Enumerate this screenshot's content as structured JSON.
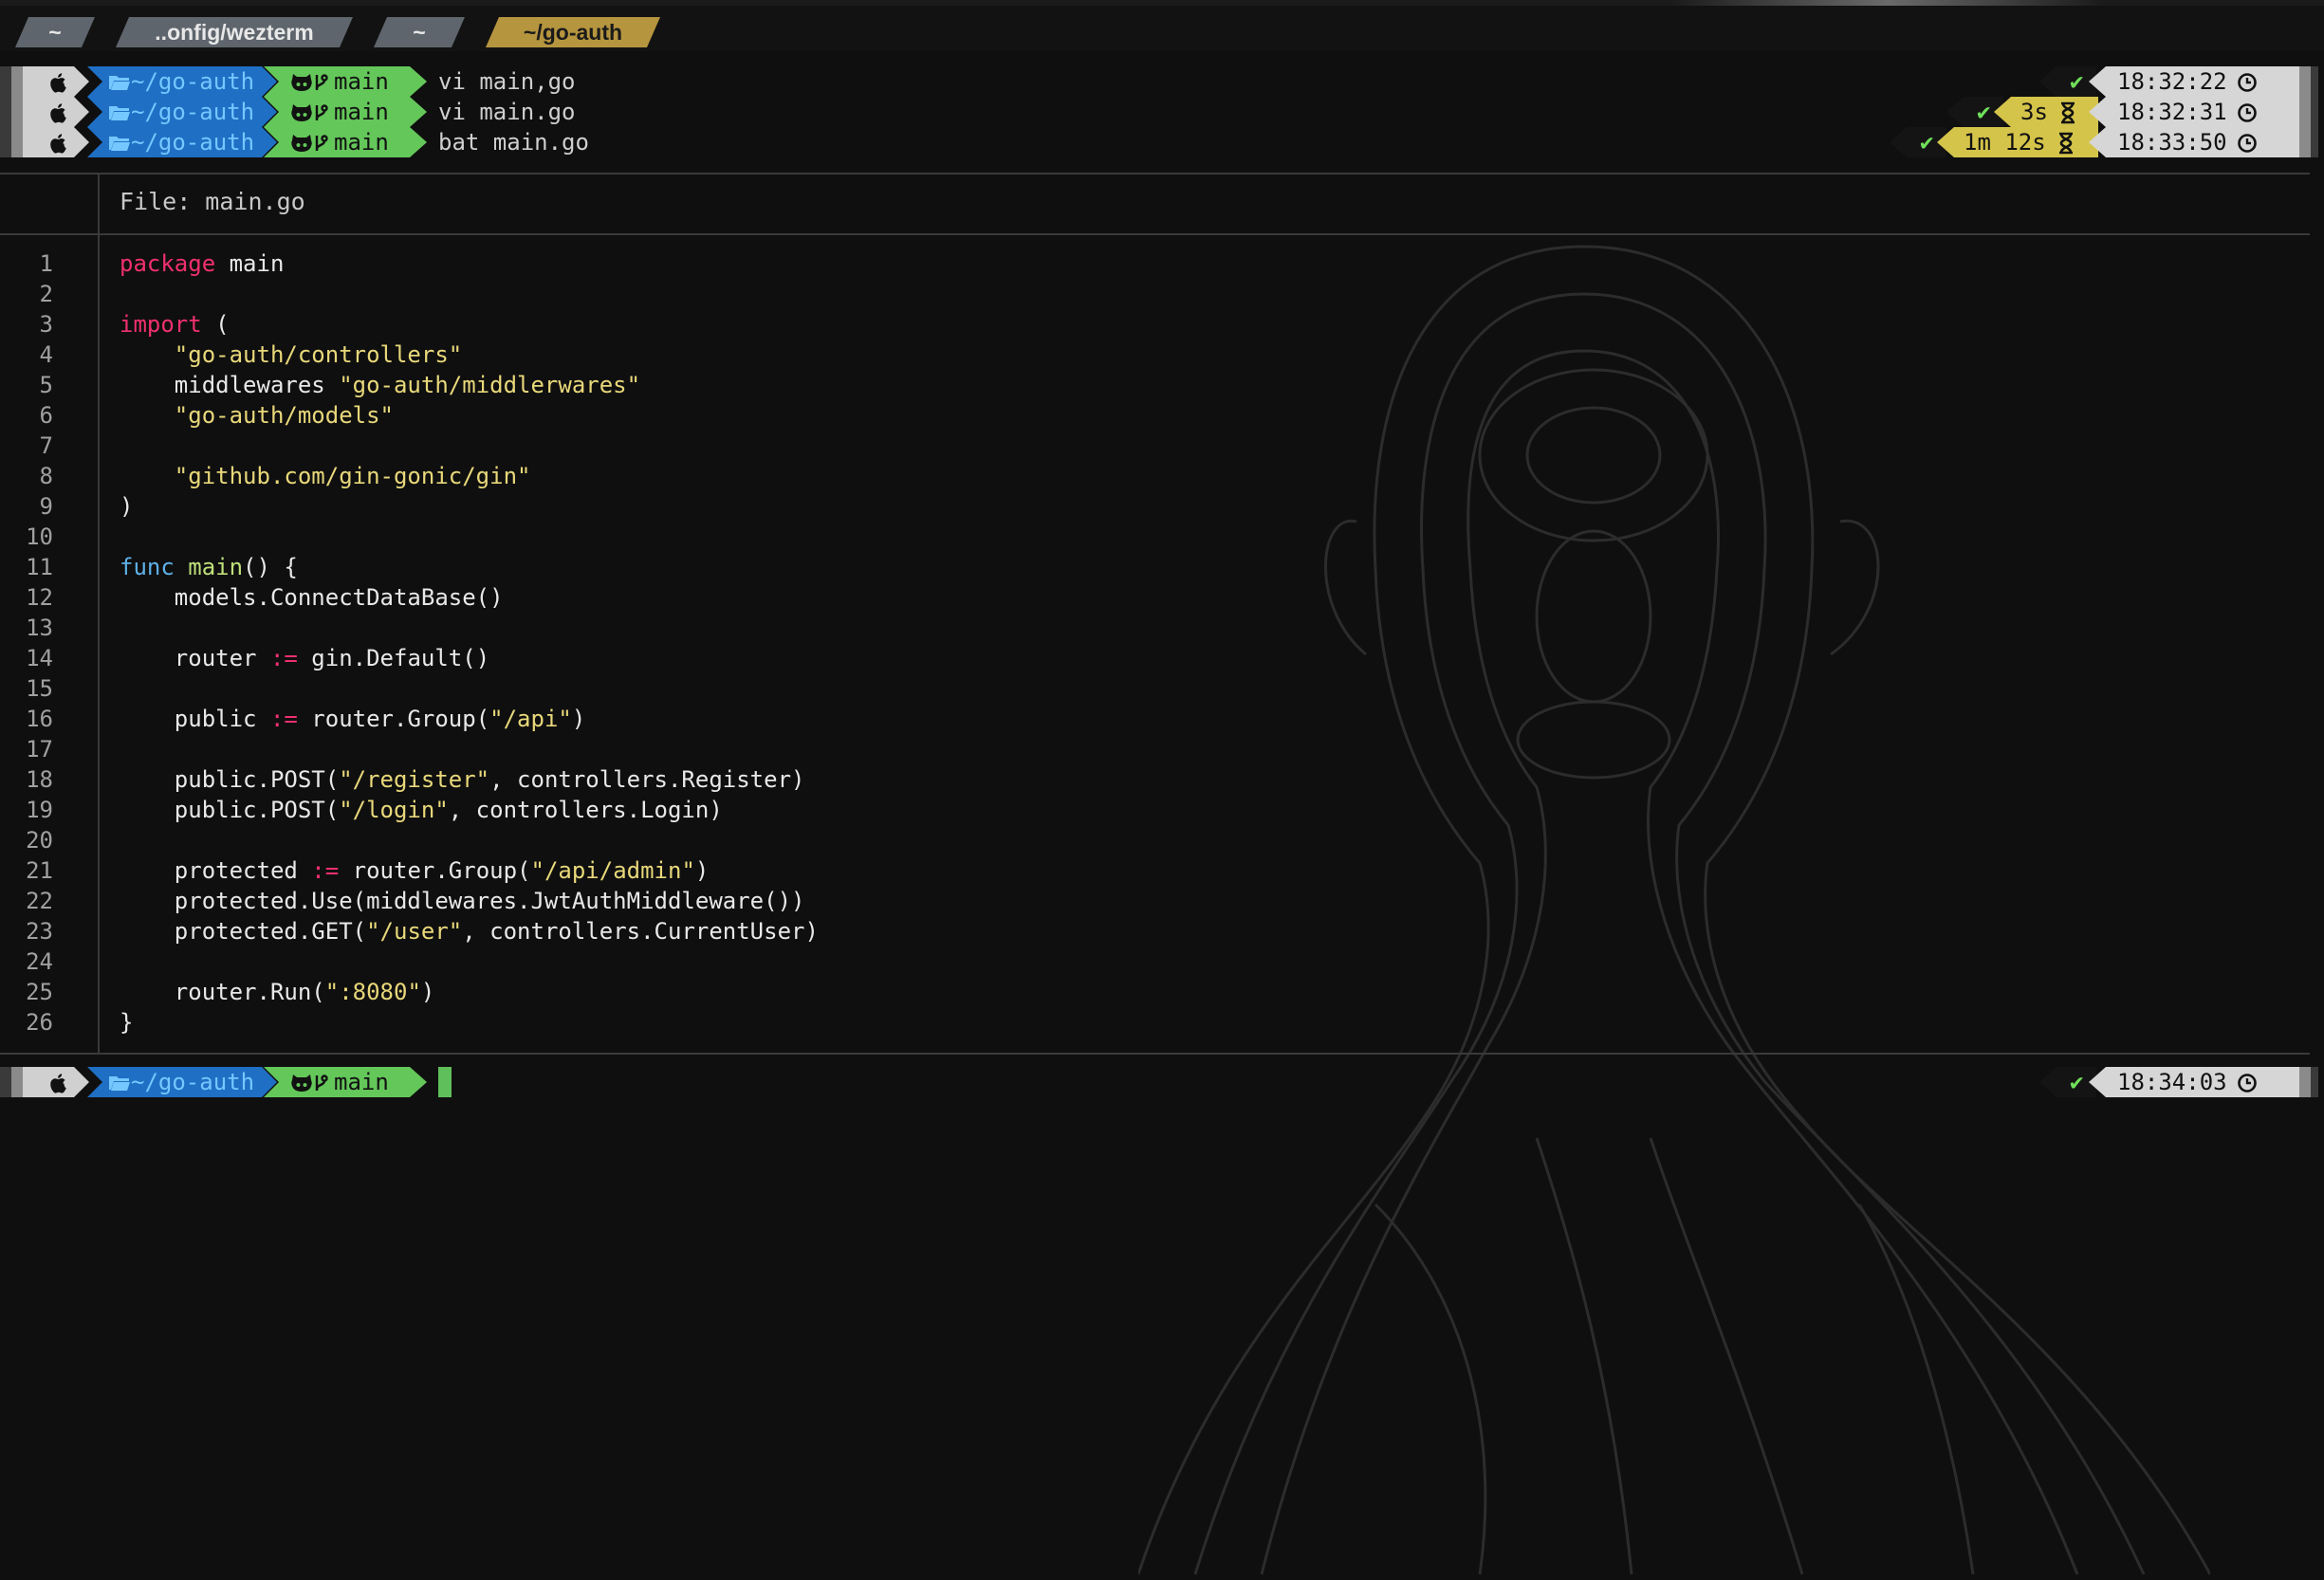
{
  "tabs": [
    {
      "label": "~",
      "active": false
    },
    {
      "label": "..onfig/wezterm",
      "active": false
    },
    {
      "label": "~",
      "active": false
    },
    {
      "label": "~/go-auth",
      "active": true
    }
  ],
  "history": [
    {
      "dir": "~/go-auth",
      "branch": "main",
      "command": "vi main,go",
      "status": "✔",
      "duration": "",
      "time": "18:32:22"
    },
    {
      "dir": "~/go-auth",
      "branch": "main",
      "command": "vi main.go",
      "status": "✔",
      "duration": "3s",
      "time": "18:32:31"
    },
    {
      "dir": "~/go-auth",
      "branch": "main",
      "command": "bat main.go",
      "status": "✔",
      "duration": "1m 12s",
      "time": "18:33:50"
    }
  ],
  "viewer": {
    "file_label": "File: main.go"
  },
  "code_lines": [
    {
      "n": "1",
      "tokens": [
        {
          "t": "package",
          "c": "kw"
        },
        {
          "t": " main",
          "c": ""
        }
      ]
    },
    {
      "n": "2",
      "tokens": []
    },
    {
      "n": "3",
      "tokens": [
        {
          "t": "import",
          "c": "kw"
        },
        {
          "t": " (",
          "c": ""
        }
      ]
    },
    {
      "n": "4",
      "tokens": [
        {
          "t": "    ",
          "c": ""
        },
        {
          "t": "\"go-auth/controllers\"",
          "c": "str"
        }
      ]
    },
    {
      "n": "5",
      "tokens": [
        {
          "t": "    middlewares ",
          "c": ""
        },
        {
          "t": "\"go-auth/middlerwares\"",
          "c": "str"
        }
      ]
    },
    {
      "n": "6",
      "tokens": [
        {
          "t": "    ",
          "c": ""
        },
        {
          "t": "\"go-auth/models\"",
          "c": "str"
        }
      ]
    },
    {
      "n": "7",
      "tokens": []
    },
    {
      "n": "8",
      "tokens": [
        {
          "t": "    ",
          "c": ""
        },
        {
          "t": "\"github.com/gin-gonic/gin\"",
          "c": "str"
        }
      ]
    },
    {
      "n": "9",
      "tokens": [
        {
          "t": ")",
          "c": ""
        }
      ]
    },
    {
      "n": "10",
      "tokens": []
    },
    {
      "n": "11",
      "tokens": [
        {
          "t": "func",
          "c": "kw2"
        },
        {
          "t": " ",
          "c": ""
        },
        {
          "t": "main",
          "c": "fn"
        },
        {
          "t": "() {",
          "c": ""
        }
      ]
    },
    {
      "n": "12",
      "tokens": [
        {
          "t": "    models.ConnectDataBase()",
          "c": ""
        }
      ]
    },
    {
      "n": "13",
      "tokens": []
    },
    {
      "n": "14",
      "tokens": [
        {
          "t": "    router ",
          "c": ""
        },
        {
          "t": ":=",
          "c": "op"
        },
        {
          "t": " gin.Default()",
          "c": ""
        }
      ]
    },
    {
      "n": "15",
      "tokens": []
    },
    {
      "n": "16",
      "tokens": [
        {
          "t": "    public ",
          "c": ""
        },
        {
          "t": ":=",
          "c": "op"
        },
        {
          "t": " router.Group(",
          "c": ""
        },
        {
          "t": "\"/api\"",
          "c": "str"
        },
        {
          "t": ")",
          "c": ""
        }
      ]
    },
    {
      "n": "17",
      "tokens": []
    },
    {
      "n": "18",
      "tokens": [
        {
          "t": "    public.POST(",
          "c": ""
        },
        {
          "t": "\"/register\"",
          "c": "str"
        },
        {
          "t": ", controllers.Register)",
          "c": ""
        }
      ]
    },
    {
      "n": "19",
      "tokens": [
        {
          "t": "    public.POST(",
          "c": ""
        },
        {
          "t": "\"/login\"",
          "c": "str"
        },
        {
          "t": ", controllers.Login)",
          "c": ""
        }
      ]
    },
    {
      "n": "20",
      "tokens": []
    },
    {
      "n": "21",
      "tokens": [
        {
          "t": "    protected ",
          "c": ""
        },
        {
          "t": ":=",
          "c": "op"
        },
        {
          "t": " router.Group(",
          "c": ""
        },
        {
          "t": "\"/api/admin\"",
          "c": "str"
        },
        {
          "t": ")",
          "c": ""
        }
      ]
    },
    {
      "n": "22",
      "tokens": [
        {
          "t": "    protected.Use(middlewares.JwtAuthMiddleware())",
          "c": ""
        }
      ]
    },
    {
      "n": "23",
      "tokens": [
        {
          "t": "    protected.GET(",
          "c": ""
        },
        {
          "t": "\"/user\"",
          "c": "str"
        },
        {
          "t": ", controllers.CurrentUser)",
          "c": ""
        }
      ]
    },
    {
      "n": "24",
      "tokens": []
    },
    {
      "n": "25",
      "tokens": [
        {
          "t": "    router.Run(",
          "c": ""
        },
        {
          "t": "\":8080\"",
          "c": "str"
        },
        {
          "t": ")",
          "c": ""
        }
      ]
    },
    {
      "n": "26",
      "tokens": [
        {
          "t": "}",
          "c": ""
        }
      ]
    }
  ],
  "current_prompt": {
    "dir": "~/go-auth",
    "branch": "main",
    "status": "✔",
    "time": "18:34:03"
  },
  "icons": {
    "os": "apple-icon",
    "folder": "folder-icon",
    "git": "github-icon",
    "branch": "branch-icon",
    "duration": "hourglass-icon",
    "time": "clock-icon"
  },
  "colors": {
    "background": "#0f0f0f",
    "tab_active": "#b5953e",
    "tab_inactive": "#5e656c",
    "dir_segment": "#1f6fc4",
    "git_segment": "#64c75a",
    "duration_segment": "#d4c44a",
    "time_segment": "#d6d6d6",
    "keyword": "#f0306e",
    "string": "#e8d87a"
  }
}
